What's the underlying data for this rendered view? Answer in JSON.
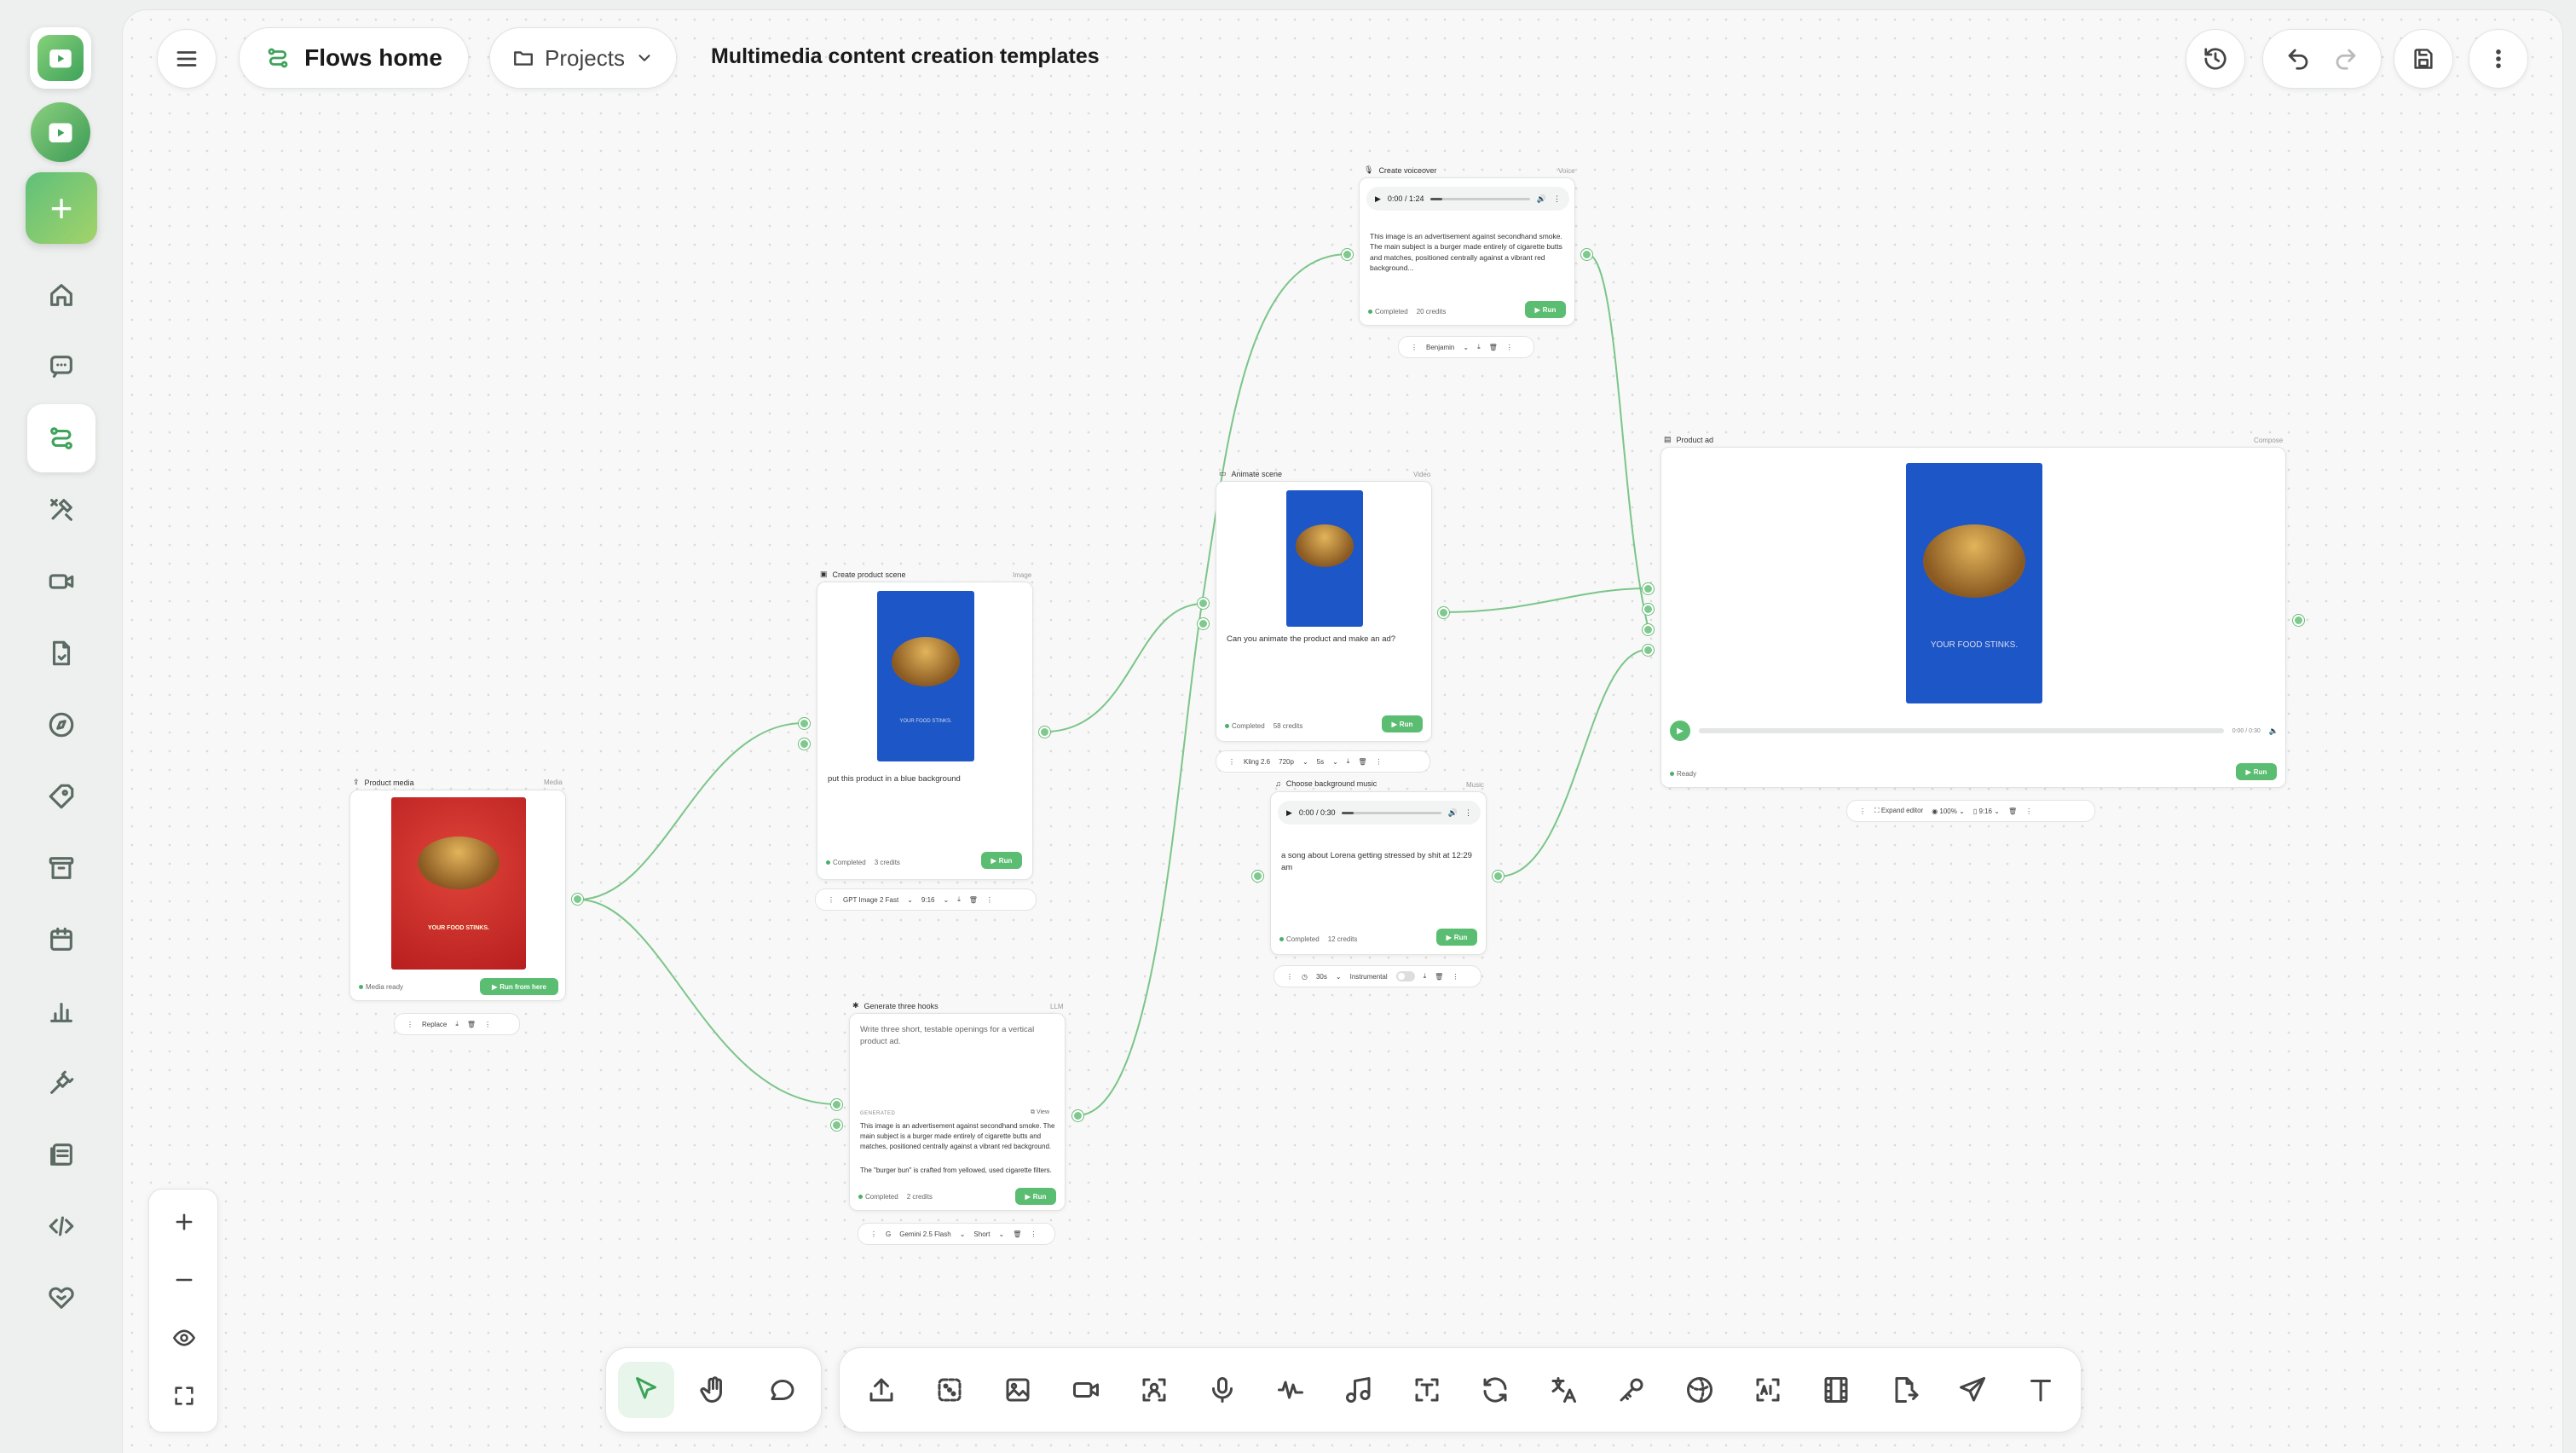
{
  "app": {
    "accent": "#5bbd72",
    "brand": "#3ea35a"
  },
  "sidebar": {
    "items": [
      {
        "id": "home",
        "icon": "home-icon"
      },
      {
        "id": "chat",
        "icon": "chat-icon"
      },
      {
        "id": "flows",
        "icon": "flows-icon",
        "active": true
      },
      {
        "id": "tools",
        "icon": "tools-icon"
      },
      {
        "id": "video",
        "icon": "video-icon"
      },
      {
        "id": "file",
        "icon": "file-icon"
      },
      {
        "id": "explore",
        "icon": "compass-icon"
      },
      {
        "id": "tags",
        "icon": "tag-icon"
      },
      {
        "id": "archive",
        "icon": "archive-icon"
      },
      {
        "id": "calendar",
        "icon": "calendar-icon"
      },
      {
        "id": "analytics",
        "icon": "bar-chart-icon"
      },
      {
        "id": "integrations",
        "icon": "plug-icon"
      },
      {
        "id": "docs",
        "icon": "docs-icon"
      },
      {
        "id": "api",
        "icon": "code-icon"
      },
      {
        "id": "support",
        "icon": "handshake-icon"
      }
    ]
  },
  "header": {
    "flows_home": "Flows home",
    "projects": "Projects",
    "title": "Multimedia content creation templates"
  },
  "nodes": {
    "product_media": {
      "title": "Product media",
      "type": "Media",
      "status": "Media ready",
      "run": "Run from here",
      "sub": {
        "replace": "Replace"
      },
      "poster_text": "YOUR FOOD STINKS."
    },
    "create_scene": {
      "title": "Create product scene",
      "type": "Image",
      "prompt": "put this product in a blue background",
      "status": "Completed",
      "credits": "3 credits",
      "run": "Run",
      "sub": {
        "model": "GPT Image 2 Fast",
        "ratio": "9:16"
      },
      "poster_text": "YOUR FOOD STINKS."
    },
    "hooks": {
      "title": "Generate three hooks",
      "type": "LLM",
      "prompt": "Write three short, testable openings for a vertical product ad.",
      "generated_label": "GENERATED",
      "view": "View",
      "output1": "This image is an advertisement against secondhand smoke. The main subject is a burger made entirely of cigarette butts and matches, positioned centrally against a vibrant red background.",
      "output2": "The \"burger bun\" is crafted from yellowed, used cigarette filters.",
      "status": "Completed",
      "credits": "2 credits",
      "run": "Run",
      "sub": {
        "model": "Gemini 2.5 Flash",
        "length": "Short"
      }
    },
    "voiceover": {
      "title": "Create voiceover",
      "type": "Voice",
      "time": "0:00 / 1:24",
      "text": "This image is an advertisement against secondhand smoke. The main subject is a burger made entirely of cigarette butts and matches, positioned centrally against a vibrant red background...",
      "status": "Completed",
      "credits": "20 credits",
      "run": "Run",
      "sub": {
        "voice": "Benjamin"
      }
    },
    "animate": {
      "title": "Animate scene",
      "type": "Video",
      "prompt": "Can you animate the product and make an ad?",
      "status": "Completed",
      "credits": "58 credits",
      "run": "Run",
      "sub": {
        "model": "Kling 2.6",
        "quality": "720p",
        "duration": "5s"
      }
    },
    "music": {
      "title": "Choose background music",
      "type": "Music",
      "time": "0:00 / 0:30",
      "prompt": "a song about Lorena getting stressed by shit at 12:29 am",
      "status": "Completed",
      "credits": "12 credits",
      "run": "Run",
      "sub": {
        "duration": "30s",
        "instrumental": "Instrumental"
      }
    },
    "product_ad": {
      "title": "Product ad",
      "type": "Compose",
      "status": "Ready",
      "run": "Run",
      "time": "0:00 / 0:30",
      "poster_text": "YOUR FOOD STINKS.",
      "sub": {
        "expand": "Expand editor",
        "zoom": "100%",
        "ratio": "9:16"
      }
    }
  },
  "zoom": {
    "items": [
      "zoom-in-icon",
      "zoom-out-icon",
      "eye-icon",
      "fit-screen-icon"
    ]
  },
  "toolbar_left": [
    "cursor-icon",
    "hand-icon",
    "comment-icon"
  ],
  "toolbar_right": [
    "upload-icon",
    "dice-icon",
    "image-icon",
    "video-icon",
    "face-scan-icon",
    "microphone-icon",
    "waveform-icon",
    "music-icon",
    "text-box-icon",
    "refresh-icon",
    "translate-icon",
    "key-icon",
    "sphere-icon",
    "ai-scan-icon",
    "film-icon",
    "document-export-icon",
    "send-icon",
    "text-icon"
  ]
}
